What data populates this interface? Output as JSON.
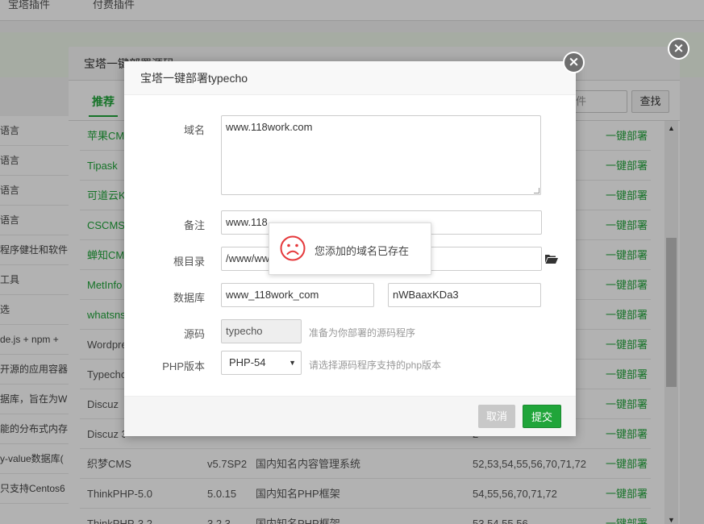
{
  "top_nav": {
    "items": [
      "宝塔插件",
      "付费插件"
    ]
  },
  "left_column": {
    "items": [
      "语言",
      "语言",
      "语言",
      "语言",
      "程序健壮和软件安",
      "工具",
      "选",
      "de.js + npm +",
      "开源的应用容器引",
      "据库，旨在为W",
      "能的分布式内存",
      "y-value数据库(",
      "只支持Centos6"
    ]
  },
  "deploy_window": {
    "title": "宝塔一键部署源码",
    "tab_recommend": "推荐",
    "search_placeholder": "件",
    "search_button": "查找",
    "rows": [
      {
        "name": "苹果CMS",
        "version": "",
        "desc": "",
        "php": "",
        "action": "一键部署",
        "green": true
      },
      {
        "name": "Tipask",
        "version": "",
        "desc": "",
        "php": "",
        "action": "一键部署",
        "green": true
      },
      {
        "name": "可道云Ke",
        "version": "",
        "desc": "",
        "php": "2",
        "action": "一键部署",
        "green": true
      },
      {
        "name": "CSCMS",
        "version": "",
        "desc": "",
        "php": "",
        "action": "一键部署",
        "green": true
      },
      {
        "name": "蝉知CMS",
        "version": "",
        "desc": "",
        "php": "",
        "action": "一键部署",
        "green": true
      },
      {
        "name": "MetInfo",
        "version": "",
        "desc": "",
        "php": "",
        "action": "一键部署",
        "green": true
      },
      {
        "name": "whatsns",
        "version": "",
        "desc": "",
        "php": "",
        "action": "一键部署",
        "green": true
      },
      {
        "name": "Wordpre",
        "version": "",
        "desc": "",
        "php": "2",
        "action": "一键部署",
        "green": false
      },
      {
        "name": "Typecho",
        "version": "",
        "desc": "",
        "php": "",
        "action": "一键部署",
        "green": false
      },
      {
        "name": "Discuz",
        "version": "",
        "desc": "",
        "php": "",
        "action": "一键部署",
        "green": false
      },
      {
        "name": "Discuz 3",
        "version": "",
        "desc": "",
        "php": "2",
        "action": "一键部署",
        "green": false
      },
      {
        "name": "织梦CMS",
        "version": "v5.7SP2",
        "desc": "国内知名内容管理系统",
        "php": "52,53,54,55,56,70,71,72",
        "action": "一键部署",
        "green": false
      },
      {
        "name": "ThinkPHP-5.0",
        "version": "5.0.15",
        "desc": "国内知名PHP框架",
        "php": "54,55,56,70,71,72",
        "action": "一键部署",
        "green": false
      },
      {
        "name": "ThinkPHP-3.2",
        "version": "3.2.3",
        "desc": "国内知名PHP框架",
        "php": "53,54,55,56",
        "action": "一键部署",
        "green": false
      }
    ]
  },
  "dialog": {
    "title": "宝塔一键部署typecho",
    "domain_label": "域名",
    "domain_value": "www.118work.com",
    "remark_label": "备注",
    "remark_value": "www.118",
    "root_label": "根目录",
    "root_value": "/www/ww",
    "db_label": "数据库",
    "db_name": "www_118work_com",
    "db_password": "nWBaaxKDa3",
    "source_label": "源码",
    "source_value": "typecho",
    "source_hint": "准备为你部署的源码程序",
    "php_label": "PHP版本",
    "php_value": "PHP-54",
    "php_hint": "请选择源码程序支持的php版本",
    "cancel_button": "取消",
    "submit_button": "提交"
  },
  "toast": {
    "message": "您添加的域名已存在"
  },
  "colors": {
    "accent_green": "#20a53a",
    "error_red": "#e5383b"
  },
  "icons": {
    "close": "close-icon",
    "folder": "folder-open-icon",
    "toast": "sad-face-icon"
  }
}
